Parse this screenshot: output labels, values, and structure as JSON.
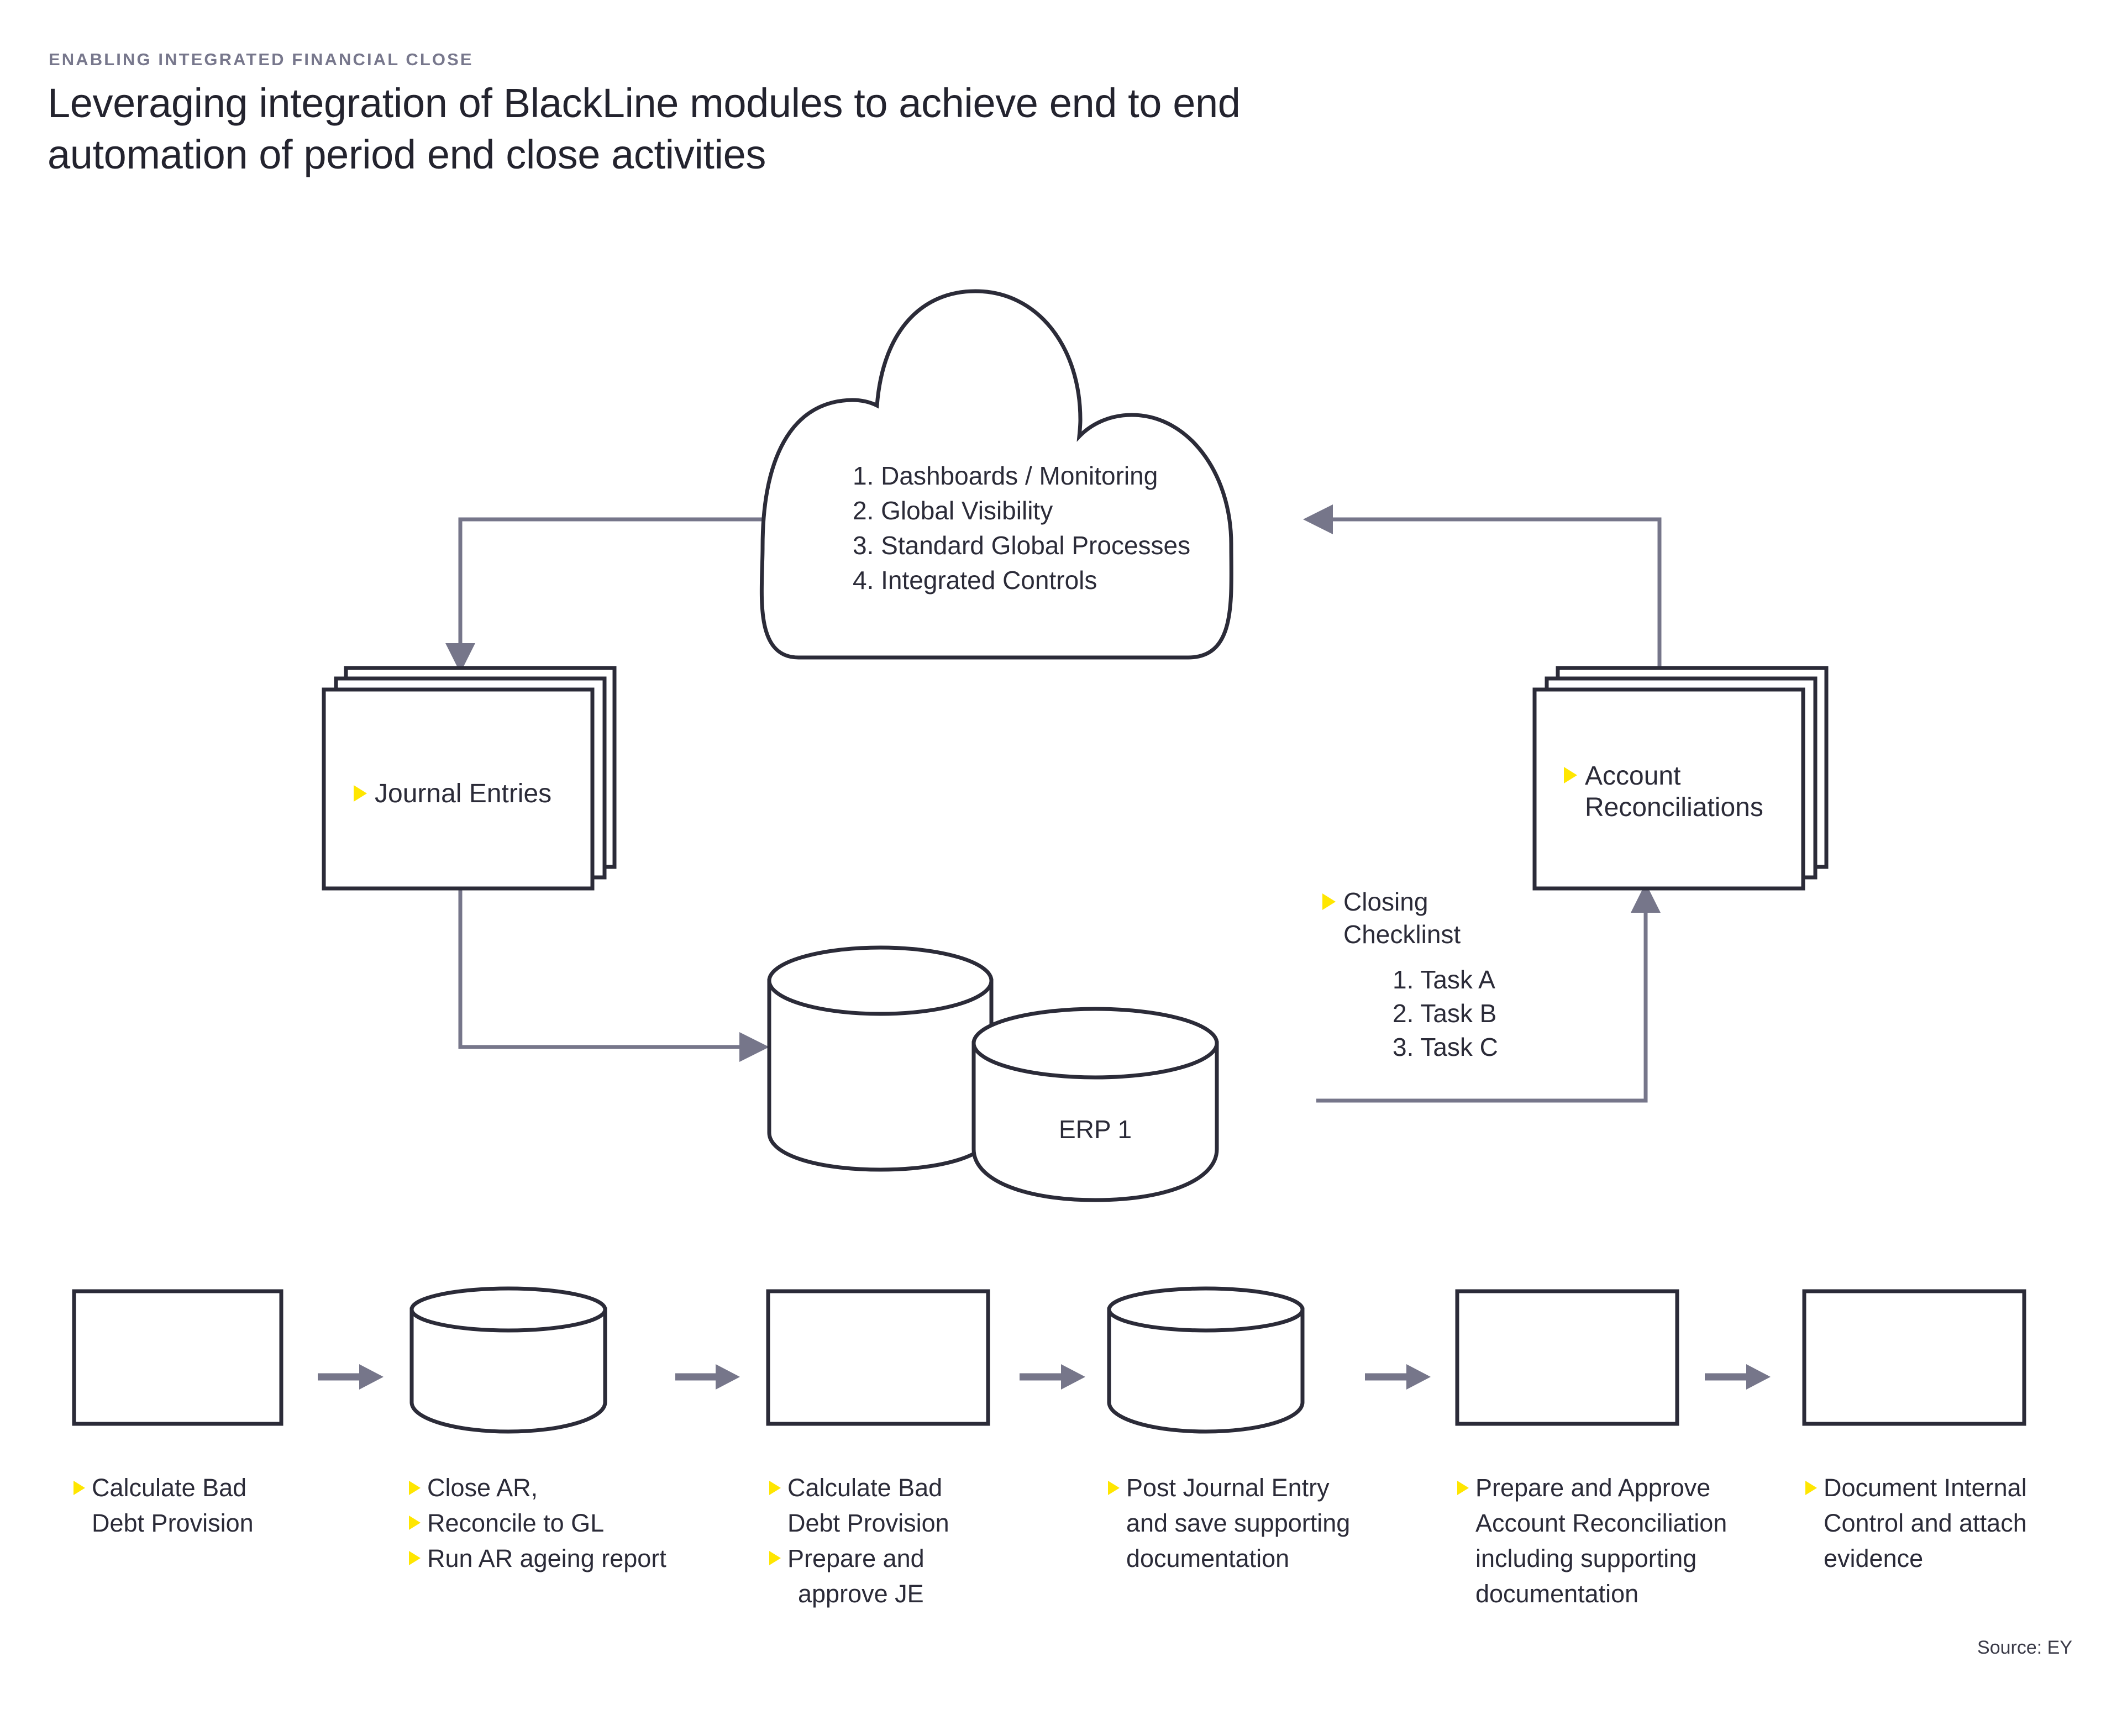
{
  "header": {
    "eyebrow": "Enabling integrated financial close",
    "title_line1": "Leveraging integration of BlackLine modules to achieve end to end",
    "title_line2": "automation of period end close activities"
  },
  "footer": {
    "source": "Source: EY"
  },
  "colors": {
    "outline": "#2b2b38",
    "connector": "#76768a",
    "bullet_accent": "#ffe600",
    "eyebrow_text": "#77778c",
    "body_text": "#2b2b38"
  },
  "diagram": {
    "cloud": {
      "name": "cloud",
      "items": [
        "1. Dashboards / Monitoring",
        "2. Global Visibility",
        "3. Standard Global Processes",
        "4. Integrated Controls"
      ]
    },
    "journal_entries": {
      "name": "stacked-cards",
      "label": "Journal Entries"
    },
    "account_reconciliations": {
      "name": "stacked-cards",
      "label_line1": "Account",
      "label_line2": "Reconciliations"
    },
    "closing_checklist": {
      "label_line1": "Closing",
      "label_line2": "Checklinst",
      "tasks": [
        "1. Task A",
        "2. Task B",
        "3. Task C"
      ]
    },
    "erp": {
      "front_label": "ERP 1",
      "back_label": ""
    },
    "connectors": [
      {
        "from": "cloud",
        "to": "journal-entries",
        "direction": "down"
      },
      {
        "from": "journal-entries",
        "to": "erp-back",
        "direction": "right"
      },
      {
        "from": "erp-front",
        "to": "account-reconciliations",
        "direction": "up"
      },
      {
        "from": "account-reconciliations",
        "to": "cloud",
        "direction": "left"
      }
    ]
  },
  "process_flow": {
    "steps": [
      {
        "shape": "rectangle",
        "bullets": [
          {
            "marker": true,
            "text": "Calculate Bad"
          },
          {
            "marker": false,
            "text": "Debt Provision"
          }
        ]
      },
      {
        "shape": "cylinder",
        "bullets": [
          {
            "marker": true,
            "text": "Close AR,"
          },
          {
            "marker": true,
            "text": "Reconcile to GL"
          },
          {
            "marker": true,
            "text": "Run AR ageing report"
          }
        ]
      },
      {
        "shape": "rectangle",
        "bullets": [
          {
            "marker": true,
            "text": "Calculate Bad"
          },
          {
            "marker": false,
            "text": "Debt Provision"
          },
          {
            "marker": true,
            "text": "Prepare and"
          },
          {
            "marker": false,
            "text": "approve JE"
          }
        ]
      },
      {
        "shape": "cylinder",
        "bullets": [
          {
            "marker": true,
            "text": "Post Journal Entry"
          },
          {
            "marker": false,
            "text": "and save supporting"
          },
          {
            "marker": false,
            "text": "documentation"
          }
        ]
      },
      {
        "shape": "rectangle",
        "bullets": [
          {
            "marker": true,
            "text": "Prepare and Approve"
          },
          {
            "marker": false,
            "text": "Account Reconciliation"
          },
          {
            "marker": false,
            "text": "including supporting"
          },
          {
            "marker": false,
            "text": "documentation"
          }
        ]
      },
      {
        "shape": "rectangle",
        "bullets": [
          {
            "marker": true,
            "text": "Document Internal"
          },
          {
            "marker": false,
            "text": "Control and attach"
          },
          {
            "marker": false,
            "text": "evidence"
          }
        ]
      }
    ]
  }
}
